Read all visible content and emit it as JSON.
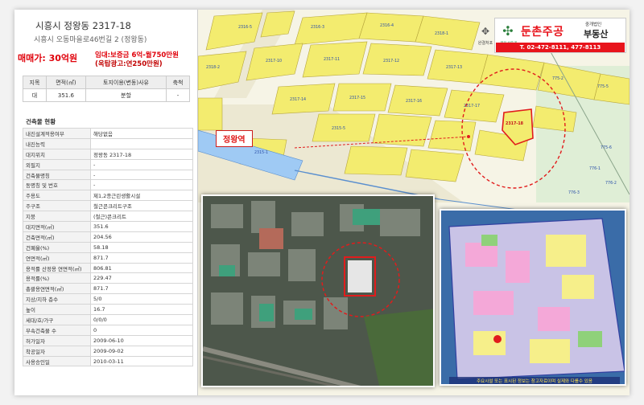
{
  "listing": {
    "address_line1": "시흥시 정왕동 2317-18",
    "address_line2": "시흥시 오동마을로46번길 2 (정왕동)",
    "price": "매매가: 30억원",
    "rent_line1": "임대:보증금 6억-월750만원",
    "rent_line2": "(옥탑광고:연250만원)"
  },
  "land_table": {
    "headers": [
      "지목",
      "면적(㎡)",
      "토지이용(변동)사유",
      "축척"
    ],
    "row": [
      "대",
      "351.6",
      "분할",
      "-"
    ]
  },
  "building": {
    "section_title": "건축물 현황",
    "rows": [
      {
        "k": "내진설계적용여부",
        "v": "해당없음"
      },
      {
        "k": "내진능력",
        "v": ""
      },
      {
        "k": "대지위치",
        "v": "정왕동 2317-18"
      },
      {
        "k": "외필지",
        "v": "-"
      },
      {
        "k": "건축물명칭",
        "v": "-"
      },
      {
        "k": "동명칭 및 번호",
        "v": "-"
      },
      {
        "k": "주용도",
        "v": "제1,2종근린생활시설"
      },
      {
        "k": "주구조",
        "v": "철근콘크리트구조"
      },
      {
        "k": "지붕",
        "v": "(철근)콘크리트"
      },
      {
        "k": "대지면적(㎡)",
        "v": "351.6"
      },
      {
        "k": "건축면적(㎡)",
        "v": "204.56"
      },
      {
        "k": "건폐율(%)",
        "v": "58.18"
      },
      {
        "k": "연면적(㎡)",
        "v": "871.7"
      },
      {
        "k": "용적률 산정용 연면적(㎡)",
        "v": "806.81"
      },
      {
        "k": "용적률(%)",
        "v": "229.47"
      },
      {
        "k": "총괄용연면적(㎡)",
        "v": "871.7"
      },
      {
        "k": "지상/지하 층수",
        "v": "5/0"
      },
      {
        "k": "높이",
        "v": "16.7"
      },
      {
        "k": "세대/호/가구",
        "v": "0/0/0"
      },
      {
        "k": "부속건축물 수",
        "v": "0"
      },
      {
        "k": "허가일자",
        "v": "2009-06-10"
      },
      {
        "k": "착공일자",
        "v": "2009-09-02"
      },
      {
        "k": "사용승인일",
        "v": "2010-03-11"
      }
    ]
  },
  "agency": {
    "name": "둔촌주공",
    "tag_top": "중개법인",
    "tag_main": "부동산",
    "phone": "T. 02-472-8111, 477-8113",
    "logo_sub": "부동산중개"
  },
  "map": {
    "station_label": "정왕역",
    "tool_label": "완결처포",
    "zoning_caption": "주요시설 또는 표시된 정보는 참고자료이며 실제와 다를수 있음",
    "lot_labels": [
      "2317-18",
      "2317-17",
      "2317-16",
      "2317-15",
      "2317-14",
      "2317-13",
      "2317-12",
      "2317-11",
      "2317-10",
      "2316-4",
      "2316-5",
      "2316-3",
      "2318-1",
      "2318-2",
      "2315-5",
      "2315-1",
      "775-2",
      "775-5",
      "775-6",
      "776-1",
      "776-2",
      "776-3"
    ],
    "colors": {
      "parcel_fill": "#f3ec6f",
      "parcel_stroke": "#b6a53c",
      "highlight": "#e11c1c",
      "road": "#e7e3cc",
      "rail": "#89bff4"
    }
  }
}
